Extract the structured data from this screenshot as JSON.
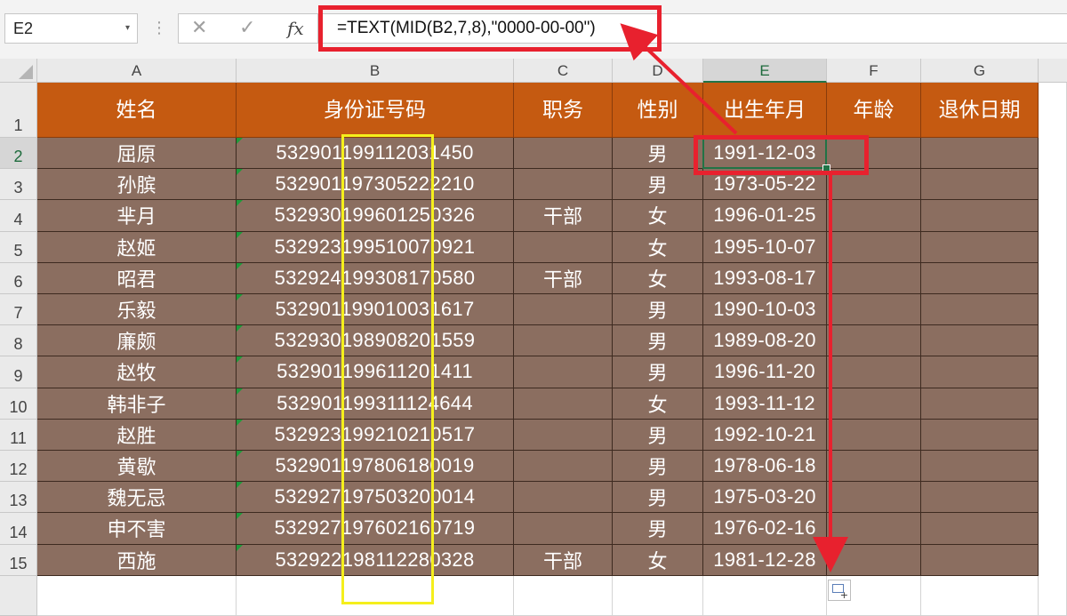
{
  "namebox": {
    "value": "E2"
  },
  "formula_bar": {
    "formula": "=TEXT(MID(B2,7,8),\"0000-00-00\")"
  },
  "toolbar": {
    "cancel_glyph": "✕",
    "enter_glyph": "✓",
    "fx_label": "fx",
    "dots": "⋮",
    "dropdown": "▾"
  },
  "columns": [
    "A",
    "B",
    "C",
    "D",
    "E",
    "F",
    "G"
  ],
  "rows": [
    "1",
    "2",
    "3",
    "4",
    "5",
    "6",
    "7",
    "8",
    "9",
    "10",
    "11",
    "12",
    "13",
    "14",
    "15"
  ],
  "selected": {
    "column": "E",
    "row": "2"
  },
  "table": {
    "headers": [
      "姓名",
      "身份证号码",
      "职务",
      "性别",
      "出生年月",
      "年龄",
      "退休日期"
    ],
    "records": [
      [
        "屈原",
        "532901199112031450",
        "",
        "男",
        "1991-12-03",
        "",
        ""
      ],
      [
        "孙膑",
        "532901197305222210",
        "",
        "男",
        "1973-05-22",
        "",
        ""
      ],
      [
        "芈月",
        "532930199601250326",
        "干部",
        "女",
        "1996-01-25",
        "",
        ""
      ],
      [
        "赵姬",
        "532923199510070921",
        "",
        "女",
        "1995-10-07",
        "",
        ""
      ],
      [
        "昭君",
        "532924199308170580",
        "干部",
        "女",
        "1993-08-17",
        "",
        ""
      ],
      [
        "乐毅",
        "532901199010031617",
        "",
        "男",
        "1990-10-03",
        "",
        ""
      ],
      [
        "廉颇",
        "532930198908201559",
        "",
        "男",
        "1989-08-20",
        "",
        ""
      ],
      [
        "赵牧",
        "532901199611201411",
        "",
        "男",
        "1996-11-20",
        "",
        ""
      ],
      [
        "韩非子",
        "532901199311124644",
        "",
        "女",
        "1993-11-12",
        "",
        ""
      ],
      [
        "赵胜",
        "532923199210210517",
        "",
        "男",
        "1992-10-21",
        "",
        ""
      ],
      [
        "黄歇",
        "532901197806180019",
        "",
        "男",
        "1978-06-18",
        "",
        ""
      ],
      [
        "魏无忌",
        "532927197503200014",
        "",
        "男",
        "1975-03-20",
        "",
        ""
      ],
      [
        "申不害",
        "532927197602160719",
        "",
        "男",
        "1976-02-16",
        "",
        ""
      ],
      [
        "西施",
        "532922198112280328",
        "干部",
        "女",
        "1981-12-28",
        "",
        ""
      ]
    ]
  },
  "colors": {
    "header_fill": "#c55a11",
    "row_fill": "#8b6e60",
    "highlight_red": "#e8212e",
    "highlight_yellow": "#f5ef1c",
    "excel_green": "#217346"
  },
  "icons": {
    "cancel": "close-icon",
    "enter": "check-icon",
    "fx": "function-icon",
    "quick_analysis": "quick-analysis-icon",
    "namebox_dropdown": "chevron-down-icon"
  }
}
